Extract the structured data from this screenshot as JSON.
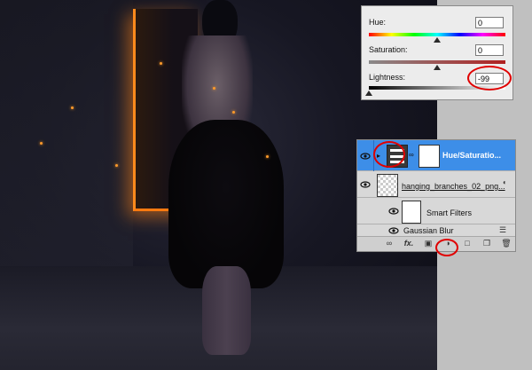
{
  "hue_saturation": {
    "hue_label": "Hue:",
    "hue_value": "0",
    "saturation_label": "Saturation:",
    "saturation_value": "0",
    "lightness_label": "Lightness:",
    "lightness_value": "-99",
    "hue_level": 0.5,
    "saturation_level": 0.5,
    "lightness_level": 0.0
  },
  "layers": {
    "adjustment_layer_name": "Hue/Saturatio...",
    "image_layer_name": "hanging_branches_02_png...",
    "smart_filters_label": "Smart Filters",
    "filter_name": "Gaussian Blur"
  },
  "icons": {
    "eye": "eye-icon",
    "link": "link-icon",
    "fx": "fx-icon",
    "mask": "mask-icon",
    "adjustment": "adjustment-layer-icon",
    "folder": "folder-icon",
    "new_layer": "new-layer-icon",
    "trash": "trash-icon"
  },
  "colors": {
    "selected_layer": "#3d8ee8",
    "annotation_red": "#e00000",
    "door_glow": "#ff8a1c"
  }
}
